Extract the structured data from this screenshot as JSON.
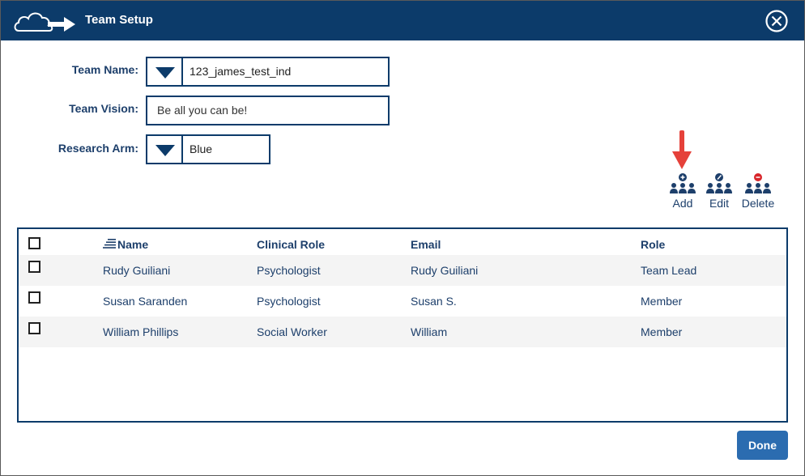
{
  "window": {
    "title": "Team Setup"
  },
  "form": {
    "team_name_label": "Team Name:",
    "team_name_value": "123_james_test_ind",
    "team_vision_label": "Team Vision:",
    "team_vision_value": "Be all you can be!",
    "research_arm_label": "Research Arm:",
    "research_arm_value": "Blue"
  },
  "actions": {
    "add_label": "Add",
    "edit_label": "Edit",
    "delete_label": "Delete"
  },
  "table": {
    "columns": [
      "Name",
      "Clinical Role",
      "Email",
      "Role"
    ],
    "rows": [
      [
        "Rudy Guiliani",
        "Psychologist",
        "Rudy Guiliani",
        "Team Lead"
      ],
      [
        "Susan Saranden",
        "Psychologist",
        "Susan S.",
        "Member"
      ],
      [
        "William Phillips",
        "Social Worker",
        "William",
        "Member"
      ]
    ]
  },
  "footer": {
    "done_label": "Done"
  },
  "icons": {
    "logo": "cloud-arrow-icon",
    "close": "close-circle-icon",
    "sort": "sort-lines-icon",
    "add": "group-add-icon",
    "edit": "group-edit-icon",
    "delete": "group-delete-icon",
    "annotation": "red-arrow-down-icon"
  },
  "colors": {
    "header_bg": "#0c3b6a",
    "text_primary": "#1d3f6b",
    "button_bg": "#2b6cb0",
    "add_badge": "#1d3f6b",
    "delete_badge": "#d9262b",
    "annotation_arrow": "#e5413a"
  }
}
